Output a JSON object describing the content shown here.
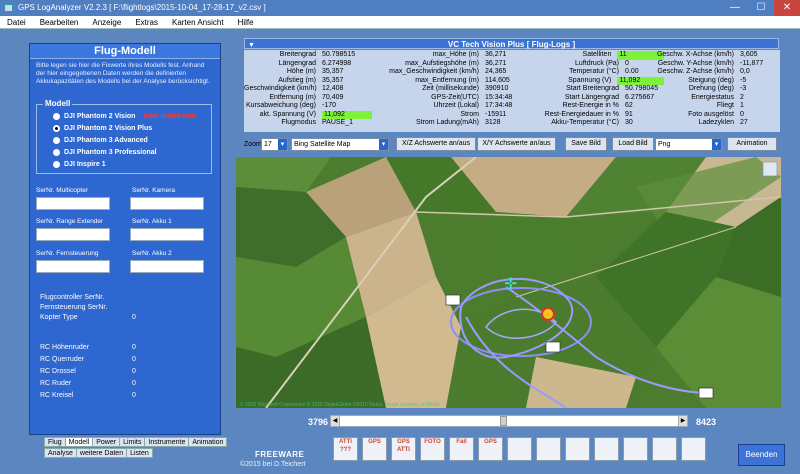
{
  "window": {
    "title": "GPS LogAnalyzer V2.2.3    [ F:\\flightlogs\\2015-10-04_17-28-17_v2.csv ]"
  },
  "menu": [
    "Datei",
    "Bearbeiten",
    "Anzeige",
    "Extras",
    "Karten Ansicht",
    "Hilfe"
  ],
  "left": {
    "title": "Flug-Modell",
    "desc": "Bitte legen sie hier die Fixwerte ihres Modells fest. Anhand der hier eingegebenen Daten werden die definierten Akkukapazitäten des Modells bei der Analyse berücksichtigt.",
    "model_caption": "Modell",
    "models": [
      {
        "label": "DJI Phantom 2 Vision",
        "note": "oder unbekannt"
      },
      {
        "label": "DJI Phantom 2 Vision Plus",
        "note": ""
      },
      {
        "label": "DJI Phantom 3 Advanced",
        "note": ""
      },
      {
        "label": "DJI Phantom 3 Professional",
        "note": ""
      },
      {
        "label": "DJI Inspire 1",
        "note": ""
      }
    ],
    "selected_model": "DJI Phantom 2 Vision Plus",
    "fields": {
      "multicopter": "SerNr. Multicopter",
      "kamera": "SerNr. Kamera",
      "extender": "SerNr. Range Extender",
      "akku1": "SerNr. Akku 1",
      "fernsteuerung": "SerNr. Fernsteuerung",
      "akku2": "SerNr. Akku 2"
    },
    "info": [
      {
        "label": "Flugcontroller SerNr.",
        "value": ""
      },
      {
        "label": "Fernsteuerung SerNr.",
        "value": ""
      },
      {
        "label": "Kopter Type",
        "value": "0"
      }
    ],
    "rc": [
      {
        "label": "RC Höhenruder",
        "value": "0"
      },
      {
        "label": "RC Querruder",
        "value": "0"
      },
      {
        "label": "RC Drossel",
        "value": "0"
      },
      {
        "label": "RC Ruder",
        "value": "0"
      },
      {
        "label": "RC Kreisel",
        "value": "0"
      }
    ],
    "tabs_row1": [
      "Flug",
      "Modell",
      "Power",
      "Limits",
      "Instrumente",
      "Animation"
    ],
    "tabs_row2": [
      "Analyse",
      "weitere Daten",
      "Listen"
    ],
    "active_tab": "Modell"
  },
  "footer": {
    "freeware": "FREEWARE",
    "copyright": "©2015  bei D.Teichert"
  },
  "panel": {
    "title": "VC Tech Vision Plus  [ Flug-Logs ]",
    "col1": [
      {
        "label": "Breitengrad",
        "value": "50.798515"
      },
      {
        "label": "Längengrad",
        "value": "6.274998"
      },
      {
        "label": "Höhe (m)",
        "value": "35,357"
      },
      {
        "label": "Aufstieg (m)",
        "value": "35,357"
      },
      {
        "label": "Geschwindigkeit (km/h)",
        "value": "12,408"
      },
      {
        "label": "Entfernung (m)",
        "value": "70,409"
      },
      {
        "label": "Kursabweichung (deg)",
        "value": "-170"
      },
      {
        "label": "akt. Spannung (V)",
        "value": "11,092"
      },
      {
        "label": "Flugmodus",
        "value": "PAUSE_1"
      }
    ],
    "col2": [
      {
        "label": "max_Höhe (m)",
        "value": "36,271"
      },
      {
        "label": "max_Aufstiegshöhe (m)",
        "value": "36,271"
      },
      {
        "label": "max_Geschwindigkeit (km/h)",
        "value": "24,365"
      },
      {
        "label": "max_Entfernung (m)",
        "value": "114,605"
      },
      {
        "label": "Zeit (millisekunde)",
        "value": "390910"
      },
      {
        "label": "GPS-Zeit(UTC)",
        "value": "15:34:48"
      },
      {
        "label": "Uhrzeit (Lokal)",
        "value": "17:34:48"
      },
      {
        "label": "Strom",
        "value": "-15911"
      },
      {
        "label": "Strom Ladung(mAh)",
        "value": "3128"
      }
    ],
    "col3": [
      {
        "label": "Satelliten",
        "value": "11"
      },
      {
        "label": "Luftdruck (Pa)",
        "value": "0"
      },
      {
        "label": "Temperatur (°C)",
        "value": "0.00"
      },
      {
        "label": "Spannung (V)",
        "value": "11,092"
      },
      {
        "label": "Start Breitengrad",
        "value": "50.798045"
      },
      {
        "label": "Start Längengrad",
        "value": "6.275667"
      },
      {
        "label": "Rest-Energie in %",
        "value": "62"
      },
      {
        "label": "Rest-Energiedauer in %",
        "value": "91"
      },
      {
        "label": "Akku-Temperatur (°C)",
        "value": "30"
      }
    ],
    "col4": [
      {
        "label": "Geschw. X-Achse (km/h)",
        "value": "3,605"
      },
      {
        "label": "Geschw. Y-Achse (km/h)",
        "value": "-11,877"
      },
      {
        "label": "Geschw. Z-Achse (km/h)",
        "value": "0,0"
      },
      {
        "label": "Steigung (deg)",
        "value": "-5"
      },
      {
        "label": "Drehung (deg)",
        "value": "-3"
      },
      {
        "label": "Energiestatus",
        "value": "2"
      },
      {
        "label": "Fliegt",
        "value": "1"
      },
      {
        "label": "Foto ausgelöst",
        "value": "0"
      },
      {
        "label": "Ladezyklen",
        "value": "27"
      }
    ],
    "highlight_color": "#7ef23a"
  },
  "toolbar": {
    "zoom_label": "Zoom",
    "zoom_value": "17",
    "map_type": "Bing Satellite Map",
    "x_axis": "X/Z Achswerte an/aus",
    "y_axis": "X/Y Achswerte an/aus",
    "save": "Save Bild",
    "load": "Load Bild",
    "format": "Png",
    "animation": "Animation"
  },
  "map": {
    "credit": "© 2015 Microsoft Corporation © 2015 DigitalGlobe ©2015 Nokia, Image courtesy of NASA"
  },
  "timeline": {
    "start": "3796",
    "end": "8423",
    "position": 0.48
  },
  "tools": [
    {
      "name": "atti-unknown-icon",
      "label": "ATTI ???"
    },
    {
      "name": "gps-icon",
      "label": "GPS"
    },
    {
      "name": "gps-atti-icon",
      "label": "GPS ATTI"
    },
    {
      "name": "foto-icon",
      "label": "FOTO"
    },
    {
      "name": "gps-fail-icon",
      "label": "Fail"
    },
    {
      "name": "atti-gps-icon",
      "label": "GPS"
    },
    {
      "name": "blank-icon",
      "label": ""
    },
    {
      "name": "warning-icon",
      "label": ""
    },
    {
      "name": "drone-x-icon",
      "label": ""
    },
    {
      "name": "route-icon",
      "label": ""
    },
    {
      "name": "waypoint-icon",
      "label": ""
    },
    {
      "name": "target-icon",
      "label": ""
    },
    {
      "name": "target2-icon",
      "label": ""
    }
  ],
  "beenden": "Beenden"
}
